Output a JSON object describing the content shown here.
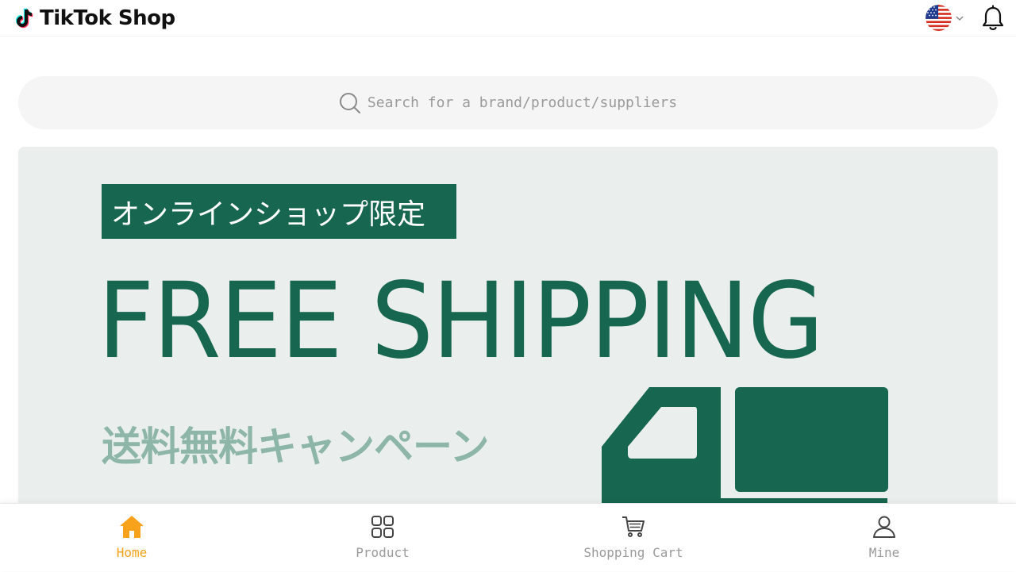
{
  "header": {
    "logo_text": "TikTok Shop",
    "language_flag": "us-flag-icon",
    "notification_icon": "bell-icon"
  },
  "search": {
    "placeholder": "Search for a brand/product/suppliers"
  },
  "banner": {
    "tag": "オンラインショップ限定",
    "headline": "FREE SHIPPING",
    "subheadline": "送料無料キャンペーン",
    "colors": {
      "primary": "#17664f",
      "secondary": "#8db6a8",
      "background": "#eaefed"
    }
  },
  "bottom_nav": {
    "items": [
      {
        "label": "Home",
        "icon": "home-icon",
        "active": true
      },
      {
        "label": "Product",
        "icon": "grid-icon",
        "active": false
      },
      {
        "label": "Shopping Cart",
        "icon": "cart-icon",
        "active": false
      },
      {
        "label": "Mine",
        "icon": "user-icon",
        "active": false
      }
    ],
    "active_color": "#f7a21a"
  }
}
